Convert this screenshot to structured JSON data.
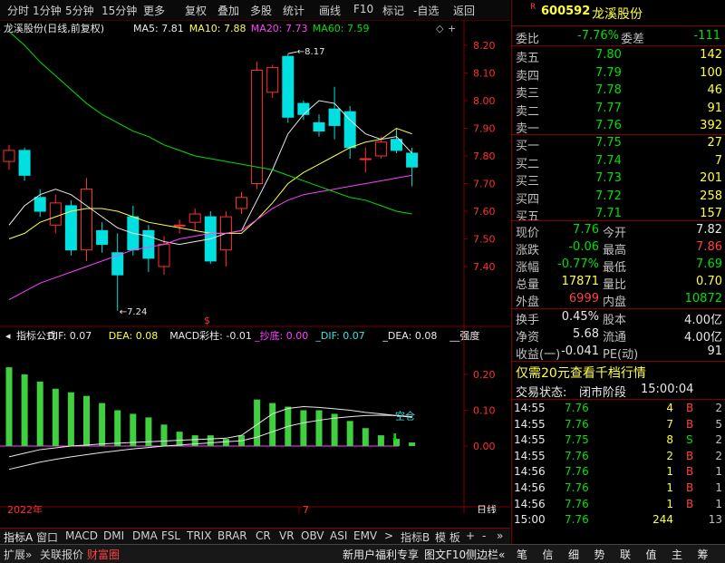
{
  "toolbar": {
    "items": [
      "分时",
      "1分钟",
      "5分钟",
      "15分钟",
      "更多",
      "复权",
      "叠加",
      "多股",
      "统计",
      "画线",
      "F10",
      "标记",
      "-自选",
      "返回"
    ]
  },
  "chart": {
    "title": "龙溪股份(日线,前复权)",
    "ma_legend": [
      {
        "label": "MA5: 7.81",
        "color": "#e8e8e8"
      },
      {
        "label": "MA10: 7.88",
        "color": "#ffff40"
      },
      {
        "label": "MA20: 7.73",
        "color": "#ff40ff"
      },
      {
        "label": "MA60: 7.59",
        "color": "#00e000"
      }
    ],
    "price_ticks": [
      "8.20",
      "8.10",
      "8.00",
      "7.90",
      "7.80",
      "7.70",
      "7.60",
      "7.50",
      "7.40"
    ],
    "high_label": "8.17",
    "low_label": "7.24",
    "dollar_mark": "$",
    "year_label": "2022年",
    "month_label": "7",
    "day_label": "日线"
  },
  "indicator": {
    "legend": [
      {
        "label": "指标公式",
        "color": "#e8e8e8"
      },
      {
        "label": "DIF: 0.07",
        "color": "#e8e8e8"
      },
      {
        "label": "DEA: 0.08",
        "color": "#ffff40"
      },
      {
        "label": "MACD彩柱: -0.01",
        "color": "#e8e8e8"
      },
      {
        "label": "_抄底: 0.00",
        "color": "#ff40ff"
      },
      {
        "label": "_DIF: 0.07",
        "color": "#40e0e0"
      },
      {
        "label": "_DEA: 0.08",
        "color": "#e8e8e8"
      },
      {
        "label": "__强度",
        "color": "#e8e8e8"
      }
    ],
    "ticks": [
      "0.20",
      "0.10",
      "0.00"
    ],
    "signal_label": "空仓"
  },
  "candles": [
    {
      "o": 7.78,
      "c": 7.82,
      "h": 7.84,
      "l": 7.75
    },
    {
      "o": 7.82,
      "c": 7.73,
      "h": 7.83,
      "l": 7.71
    },
    {
      "o": 7.65,
      "c": 7.6,
      "h": 7.68,
      "l": 7.58
    },
    {
      "o": 7.55,
      "c": 7.63,
      "h": 7.66,
      "l": 7.52
    },
    {
      "o": 7.62,
      "c": 7.46,
      "h": 7.64,
      "l": 7.44
    },
    {
      "o": 7.46,
      "c": 7.68,
      "h": 7.72,
      "l": 7.42
    },
    {
      "o": 7.53,
      "c": 7.48,
      "h": 7.56,
      "l": 7.45
    },
    {
      "o": 7.45,
      "c": 7.37,
      "h": 7.52,
      "l": 7.24
    },
    {
      "o": 7.58,
      "c": 7.46,
      "h": 7.62,
      "l": 7.44
    },
    {
      "o": 7.53,
      "c": 7.43,
      "h": 7.55,
      "l": 7.38
    },
    {
      "o": 7.4,
      "c": 7.48,
      "h": 7.51,
      "l": 7.37
    },
    {
      "o": 7.55,
      "c": 7.55,
      "h": 7.57,
      "l": 7.52
    },
    {
      "o": 7.56,
      "c": 7.59,
      "h": 7.61,
      "l": 7.53
    },
    {
      "o": 7.58,
      "c": 7.42,
      "h": 7.6,
      "l": 7.41
    },
    {
      "o": 7.46,
      "c": 7.58,
      "h": 7.6,
      "l": 7.4
    },
    {
      "o": 7.61,
      "c": 7.65,
      "h": 7.67,
      "l": 7.59
    },
    {
      "o": 7.7,
      "c": 8.11,
      "h": 8.14,
      "l": 7.68
    },
    {
      "o": 8.03,
      "c": 8.12,
      "h": 8.13,
      "l": 8.01
    },
    {
      "o": 8.16,
      "c": 7.94,
      "h": 8.17,
      "l": 7.92
    },
    {
      "o": 7.99,
      "c": 7.95,
      "h": 8.0,
      "l": 7.93
    },
    {
      "o": 7.92,
      "c": 7.89,
      "h": 7.95,
      "l": 7.87
    },
    {
      "o": 7.97,
      "c": 7.91,
      "h": 8.05,
      "l": 7.86
    },
    {
      "o": 7.96,
      "c": 7.83,
      "h": 7.98,
      "l": 7.79
    },
    {
      "o": 7.79,
      "c": 7.79,
      "h": 7.83,
      "l": 7.74
    },
    {
      "o": 7.8,
      "c": 7.85,
      "h": 7.87,
      "l": 7.79
    },
    {
      "o": 7.86,
      "c": 7.82,
      "h": 7.9,
      "l": 7.81
    },
    {
      "o": 7.81,
      "c": 7.76,
      "h": 7.83,
      "l": 7.69
    }
  ],
  "ma": {
    "ma5": [
      7.55,
      7.62,
      7.66,
      7.68,
      7.66,
      7.62,
      7.58,
      7.54,
      7.52,
      7.51,
      7.49,
      7.48,
      7.49,
      7.5,
      7.52,
      7.53,
      7.64,
      7.75,
      7.88,
      7.95,
      8.0,
      7.99,
      7.93,
      7.88,
      7.86,
      7.87,
      7.81
    ],
    "ma10": [
      7.5,
      7.52,
      7.56,
      7.58,
      7.6,
      7.61,
      7.61,
      7.6,
      7.58,
      7.56,
      7.55,
      7.54,
      7.53,
      7.52,
      7.52,
      7.52,
      7.57,
      7.63,
      7.7,
      7.74,
      7.77,
      7.8,
      7.83,
      7.85,
      7.86,
      7.9,
      7.88
    ],
    "ma20": [
      7.28,
      7.31,
      7.34,
      7.36,
      7.38,
      7.4,
      7.42,
      7.44,
      7.46,
      7.47,
      7.48,
      7.5,
      7.51,
      7.52,
      7.52,
      7.53,
      7.57,
      7.61,
      7.64,
      7.66,
      7.67,
      7.68,
      7.69,
      7.7,
      7.71,
      7.72,
      7.73
    ],
    "ma60": [
      8.25,
      8.2,
      8.14,
      8.09,
      8.04,
      7.99,
      7.95,
      7.92,
      7.89,
      7.87,
      7.84,
      7.82,
      7.8,
      7.79,
      7.78,
      7.77,
      7.76,
      7.75,
      7.73,
      7.71,
      7.69,
      7.67,
      7.65,
      7.64,
      7.62,
      7.6,
      7.59
    ]
  },
  "macd_bars": [
    0.22,
    0.2,
    0.18,
    0.16,
    0.15,
    0.14,
    0.12,
    0.1,
    0.09,
    0.08,
    0.06,
    0.04,
    0.03,
    0.03,
    0.02,
    0.03,
    0.13,
    0.12,
    0.11,
    0.1,
    0.1,
    0.09,
    0.07,
    0.05,
    0.03,
    0.02,
    0.01
  ],
  "dif": [
    -0.03,
    -0.02,
    -0.01,
    -0.005,
    0.0,
    0.003,
    0.006,
    0.008,
    0.01,
    0.012,
    0.014,
    0.016,
    0.018,
    0.02,
    0.022,
    0.03,
    0.06,
    0.09,
    0.105,
    0.11,
    0.108,
    0.104,
    0.1,
    0.094,
    0.09,
    0.085,
    0.08
  ],
  "dea": [
    -0.065,
    -0.055,
    -0.045,
    -0.037,
    -0.03,
    -0.024,
    -0.018,
    -0.013,
    -0.008,
    -0.004,
    0.0,
    0.003,
    0.006,
    0.009,
    0.012,
    0.015,
    0.025,
    0.04,
    0.055,
    0.065,
    0.072,
    0.078,
    0.082,
    0.085,
    0.086,
    0.085,
    0.082
  ],
  "quote": {
    "code": "600592",
    "name": "龙溪股份",
    "r_badge": "R",
    "webi_label": "委比",
    "webi": "-7.76%",
    "weicha_label": "委差",
    "weicha": "-111",
    "asks": [
      {
        "label": "卖五",
        "price": "7.80",
        "vol": "142"
      },
      {
        "label": "卖四",
        "price": "7.79",
        "vol": "100"
      },
      {
        "label": "卖三",
        "price": "7.78",
        "vol": "46"
      },
      {
        "label": "卖二",
        "price": "7.77",
        "vol": "91"
      },
      {
        "label": "卖一",
        "price": "7.76",
        "vol": "392"
      }
    ],
    "bids": [
      {
        "label": "买一",
        "price": "7.75",
        "vol": "27"
      },
      {
        "label": "买二",
        "price": "7.74",
        "vol": "7"
      },
      {
        "label": "买三",
        "price": "7.73",
        "vol": "201"
      },
      {
        "label": "买四",
        "price": "7.72",
        "vol": "258"
      },
      {
        "label": "买五",
        "price": "7.71",
        "vol": "157"
      }
    ],
    "stats": [
      {
        "l1": "现价",
        "v1": "7.76",
        "c1": "green",
        "l2": "今开",
        "v2": "7.82",
        "c2": "wht"
      },
      {
        "l1": "涨跌",
        "v1": "-0.06",
        "c1": "green",
        "l2": "最高",
        "v2": "7.86",
        "c2": "red"
      },
      {
        "l1": "涨幅",
        "v1": "-0.77%",
        "c1": "green",
        "l2": "最低",
        "v2": "7.69",
        "c2": "green"
      },
      {
        "l1": "总量",
        "v1": "17871",
        "c1": "yel",
        "l2": "量比",
        "v2": "0.70",
        "c2": "yel"
      },
      {
        "l1": "外盘",
        "v1": "6999",
        "c1": "red",
        "l2": "内盘",
        "v2": "10872",
        "c2": "green"
      }
    ],
    "stats2": [
      {
        "l1": "换手",
        "v1": "0.45%",
        "l2": "股本",
        "v2": "4.00亿"
      },
      {
        "l1": "净资",
        "v1": "5.68",
        "l2": "流通",
        "v2": "4.00亿"
      },
      {
        "l1": "收益(一)",
        "v1": "-0.041",
        "l2": "PE(动)",
        "v2": "91"
      }
    ],
    "promo": "仅需20元查看千档行情",
    "status_label": "交易状态:",
    "status_value": "闭市阶段",
    "status_time": "15:00:04",
    "ticks": [
      {
        "time": "14:55",
        "price": "7.76",
        "vol": "4",
        "side": "B",
        "num": "2"
      },
      {
        "time": "14:55",
        "price": "7.76",
        "vol": "7",
        "side": "B",
        "num": "5"
      },
      {
        "time": "14:55",
        "price": "7.75",
        "vol": "8",
        "side": "S",
        "num": "2"
      },
      {
        "time": "14:55",
        "price": "7.76",
        "vol": "2",
        "side": "B",
        "num": "2"
      },
      {
        "time": "14:56",
        "price": "7.76",
        "vol": "1",
        "side": "B",
        "num": "1"
      },
      {
        "time": "14:56",
        "price": "7.76",
        "vol": "1",
        "side": "B",
        "num": "1"
      },
      {
        "time": "14:56",
        "price": "7.76",
        "vol": "1",
        "side": "B",
        "num": "1"
      },
      {
        "time": "15:00",
        "price": "7.76",
        "vol": "244",
        "side": "",
        "num": "13"
      }
    ]
  },
  "tabs": [
    "指标A",
    "窗口",
    "MACD",
    "DMI",
    "DMA",
    "FSL",
    "TRIX",
    "BRAR",
    "CR",
    "VR",
    "OBV",
    "ASI",
    "EMV",
    ">",
    "指标B",
    "模 板",
    "+",
    "-",
    "»"
  ],
  "statusbar": {
    "left": [
      "扩展»",
      "关联报价",
      "财富圈"
    ],
    "right": [
      "新用户福利专享",
      "图文F10",
      "侧边栏«"
    ],
    "icons": [
      "笔",
      "信",
      "细",
      "势",
      "联",
      "值",
      "主",
      "筹"
    ]
  },
  "colors": {
    "up": "#ff3030",
    "down": "#00e0e0",
    "border": "#800000"
  }
}
